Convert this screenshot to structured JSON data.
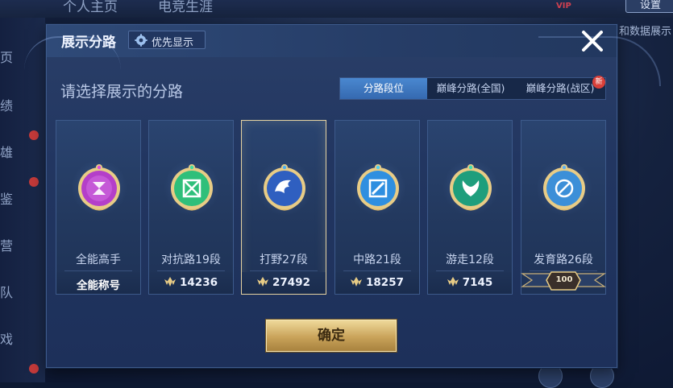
{
  "background": {
    "top_tabs": [
      "个人主页",
      "电竞生涯"
    ],
    "top_right_button": "设置",
    "vip_tag": "VIP",
    "sidebar_items": [
      "页",
      "绩",
      "雄",
      "鉴",
      "营",
      "队",
      "戏"
    ],
    "right_text": "和数据展示"
  },
  "modal": {
    "title": "展示分路",
    "priority_button": "优先显示",
    "prompt": "请选择展示的分路",
    "tabs": [
      {
        "label": "分路段位",
        "active": true
      },
      {
        "label": "巅峰分路(全国)",
        "active": false
      },
      {
        "label": "巅峰分路(战区)",
        "active": false
      }
    ],
    "new_badge": "新",
    "cards": [
      {
        "name": "全能高手",
        "footer": "全能称号",
        "score": null,
        "selected": false,
        "color": "#b43fc9"
      },
      {
        "name": "对抗路19段",
        "score": "14236",
        "selected": false,
        "color": "#2fbf7a"
      },
      {
        "name": "打野27段",
        "score": "27492",
        "selected": true,
        "color": "#2f5fc0"
      },
      {
        "name": "中路21段",
        "score": "18257",
        "selected": false,
        "color": "#2f8fe0"
      },
      {
        "name": "游走12段",
        "score": "7145",
        "selected": false,
        "color": "#1e9e7c"
      },
      {
        "name": "发育路26段",
        "score": null,
        "ribbon": "100",
        "selected": false,
        "color": "#3c8fd8"
      }
    ],
    "confirm_button": "确定"
  }
}
